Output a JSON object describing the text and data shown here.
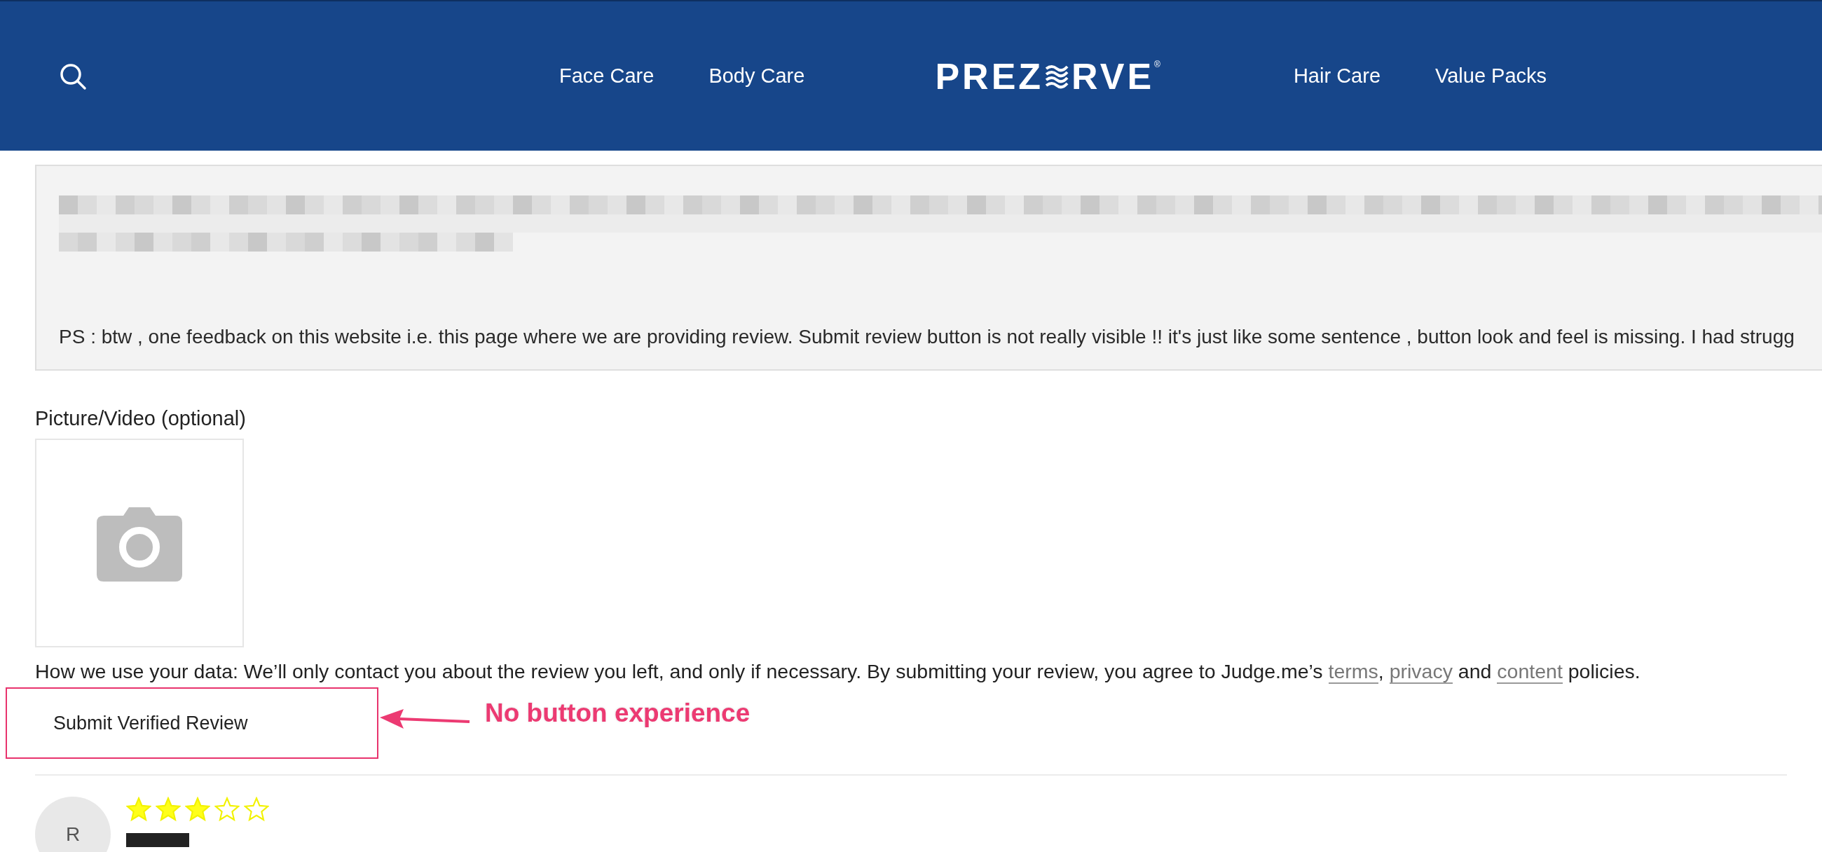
{
  "header": {
    "nav_left": [
      "Face Care",
      "Body Care"
    ],
    "logo": {
      "left": "PREZ",
      "right": "RVE",
      "mark": "®"
    },
    "nav_right": [
      "Hair Care",
      "Value Packs"
    ]
  },
  "review_field": {
    "value": "PS : btw , one feedback on this website i.e. this page where we are providing review. Submit review button is not really visible !! it's just like some sentence , button look and feel is missing. I had strugg"
  },
  "media": {
    "label": "Picture/Video (optional)"
  },
  "policy": [
    {
      "text": "How we use your data: We’ll only contact you about the review you left, and only if necessary. By submitting your review, you agree to Judge.me’s ",
      "kind": "text"
    },
    {
      "text": "terms",
      "kind": "link"
    },
    {
      "text": ", ",
      "kind": "text"
    },
    {
      "text": "privacy",
      "kind": "link"
    },
    {
      "text": " and ",
      "kind": "text"
    },
    {
      "text": "content",
      "kind": "link"
    },
    {
      "text": " policies.",
      "kind": "text"
    }
  ],
  "submit": {
    "label": "Submit Verified Review"
  },
  "annotation": {
    "text": "No button experience"
  },
  "review": {
    "initial": "R",
    "stars": 3
  }
}
